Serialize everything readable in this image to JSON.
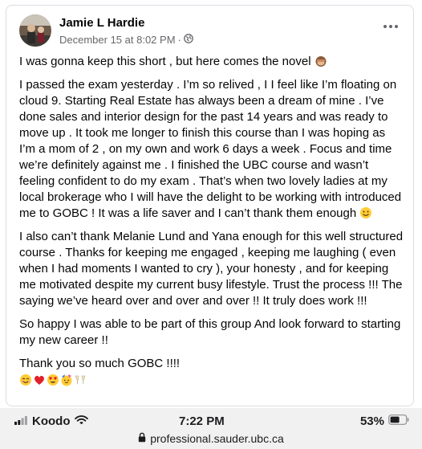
{
  "post": {
    "author": "Jamie L Hardie",
    "timestamp": "December 15 at 8:02 PM",
    "separator": "·",
    "audience_icon": "globe-icon",
    "more_icon": "more-options-icon",
    "paragraphs": [
      "I was gonna keep this short , but here comes the novel",
      "I passed the exam yesterday . I’m so relived , I I feel like I’m floating on cloud 9. Starting Real Estate has always been a dream of mine . I’ve done sales and interior design for the past 14 years and was ready to move up . It took me longer to finish this course than I was hoping   as I’m a mom of 2 , on my own and work 6 days a week . Focus and time we’re definitely against me . I finished the UBC course and wasn’t feeling confident to do my exam . That’s when two lovely ladies at my local brokerage who I will have the delight to be  working with introduced me to GOBC ! It was a life saver and I can’t thank them enough",
      "I also can’t thank Melanie Lund and Yana enough for this well structured course . Thanks for keeping me engaged , keeping me laughing ( even when I had moments I wanted to cry ), your honesty , and for keeping me motivated despite my current busy lifestyle.  Trust the process !!! The saying we’ve heard over and over and over  !! It truly does work !!!",
      "So happy I was able to be part of this group And look forward to starting my new career !!",
      "Thank you so much GOBC !!!!"
    ],
    "emojis": {
      "p1": "see-no-evil-monkey-emoji",
      "p2": "smiling-face-emoji",
      "closing": [
        "smiling-face-emoji",
        "red-heart-emoji",
        "heart-eyes-emoji",
        "partying-face-emoji",
        "clinking-glasses-emoji"
      ]
    }
  },
  "status_bar": {
    "carrier": "Koodo",
    "time": "7:22 PM",
    "battery": "53%",
    "url": "professional.sauder.ubc.ca"
  }
}
